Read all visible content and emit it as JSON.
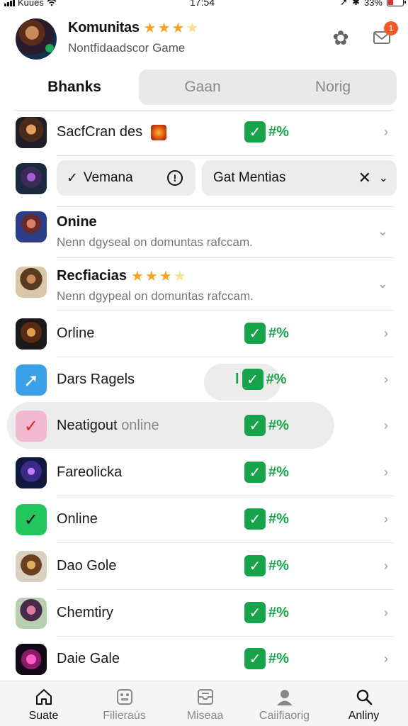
{
  "status_bar": {
    "carrier": "Kuues",
    "time": "17:54",
    "battery": "33%",
    "battery_level": 0.33
  },
  "header": {
    "title": "Komunitas",
    "rating": 3,
    "rating_max": 4,
    "subtitle": "Nontfidaadscor Game",
    "mail_badge": "1"
  },
  "tabs": [
    {
      "label": "Bhanks",
      "active": true
    },
    {
      "label": "Gaan",
      "active": false
    },
    {
      "label": "Norig",
      "active": false
    }
  ],
  "filters": {
    "left_label": "Vemana",
    "right_label": "Gat Mentias"
  },
  "rows": [
    {
      "label": "SacfCran des",
      "icon": "game-icon",
      "status": "#%"
    },
    {
      "label": "Orline",
      "icon": "game-icon",
      "status": "#%"
    },
    {
      "label": "Dars Ragels",
      "icon": "runner-icon",
      "status": "#%",
      "prefix": "l"
    },
    {
      "label": "Neatigout",
      "label_muted": "online",
      "icon": "check-icon",
      "status": "#%"
    },
    {
      "label": "Fareolicka",
      "icon": "game-icon",
      "status": "#%"
    },
    {
      "label": "Online",
      "icon": "check-icon",
      "status": "#%"
    },
    {
      "label": "Dao Gole",
      "icon": "game-icon",
      "status": "#%"
    },
    {
      "label": "Chemtiry",
      "icon": "game-icon",
      "status": "#%"
    },
    {
      "label": "Daie Gale",
      "icon": "swirl-icon",
      "status": "#%"
    }
  ],
  "expand_rows": [
    {
      "title": "Onine",
      "desc": "Nenn dgyseal on domuntas rafccam.",
      "rating": null
    },
    {
      "title": "Recfiacias",
      "desc": "Nenn dgypeal on domuntas rafccam.",
      "rating": 3
    }
  ],
  "bottom_nav": [
    {
      "label": "Suate",
      "icon": "home-icon",
      "active": true
    },
    {
      "label": "Filieraús",
      "icon": "gamepad-icon",
      "active": false
    },
    {
      "label": "Miseaa",
      "icon": "inbox-icon",
      "active": false
    },
    {
      "label": "Caiifiaorig",
      "icon": "person-icon",
      "active": false
    },
    {
      "label": "Anliny",
      "icon": "search-icon",
      "active": true
    }
  ],
  "colors": {
    "accent_green": "#16a34a",
    "star": "#f5a524",
    "badge": "#f05a28"
  }
}
